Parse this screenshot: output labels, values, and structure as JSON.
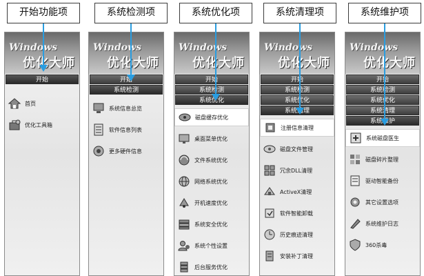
{
  "callouts": [
    {
      "label": "开始功能项"
    },
    {
      "label": "系统检测项"
    },
    {
      "label": "系统优化项"
    },
    {
      "label": "系统清理项"
    },
    {
      "label": "系统维护项"
    }
  ],
  "panel_header": {
    "wordmark": "Windows",
    "title": "优化大师"
  },
  "tabs": {
    "start": "开始",
    "check": "系统检测",
    "optimize": "系统优化",
    "clean": "系统清理",
    "maintain": "系统维护"
  },
  "panel1_items": [
    {
      "label": "首页",
      "icon": "home-icon"
    },
    {
      "label": "优化工具箱",
      "icon": "toolbox-icon"
    }
  ],
  "panel2_items": [
    {
      "label": "系统信息总览",
      "icon": "monitor-icon"
    },
    {
      "label": "软件信息列表",
      "icon": "list-icon"
    },
    {
      "label": "更多硬件信息",
      "icon": "hardware-icon"
    }
  ],
  "panel3_items": [
    {
      "label": "磁盘缓存优化",
      "icon": "disk-icon"
    },
    {
      "label": "桌面菜单优化",
      "icon": "desktop-icon"
    },
    {
      "label": "文件系统优化",
      "icon": "file-icon"
    },
    {
      "label": "网络系统优化",
      "icon": "network-icon"
    },
    {
      "label": "开机速度优化",
      "icon": "boot-icon"
    },
    {
      "label": "系统安全优化",
      "icon": "security-icon"
    },
    {
      "label": "系统个性设置",
      "icon": "user-icon"
    },
    {
      "label": "后台服务优化",
      "icon": "server-icon"
    }
  ],
  "panel4_items": [
    {
      "label": "注册信息清理",
      "icon": "registry-icon"
    },
    {
      "label": "磁盘文件管理",
      "icon": "disk-clean-icon"
    },
    {
      "label": "冗余DLL清理",
      "icon": "dll-icon"
    },
    {
      "label": "ActiveX清理",
      "icon": "activex-icon"
    },
    {
      "label": "软件智能卸载",
      "icon": "uninstall-icon"
    },
    {
      "label": "历史痕迹清理",
      "icon": "history-icon"
    },
    {
      "label": "安装补丁清理",
      "icon": "patch-icon"
    }
  ],
  "panel5_items": [
    {
      "label": "系统磁盘医生",
      "icon": "doctor-icon"
    },
    {
      "label": "磁盘碎片整理",
      "icon": "defrag-icon"
    },
    {
      "label": "驱动智能备份",
      "icon": "backup-icon"
    },
    {
      "label": "其它设置选项",
      "icon": "settings-icon"
    },
    {
      "label": "系统维护日志",
      "icon": "log-icon"
    },
    {
      "label": "360杀毒",
      "icon": "antivirus-icon"
    }
  ]
}
